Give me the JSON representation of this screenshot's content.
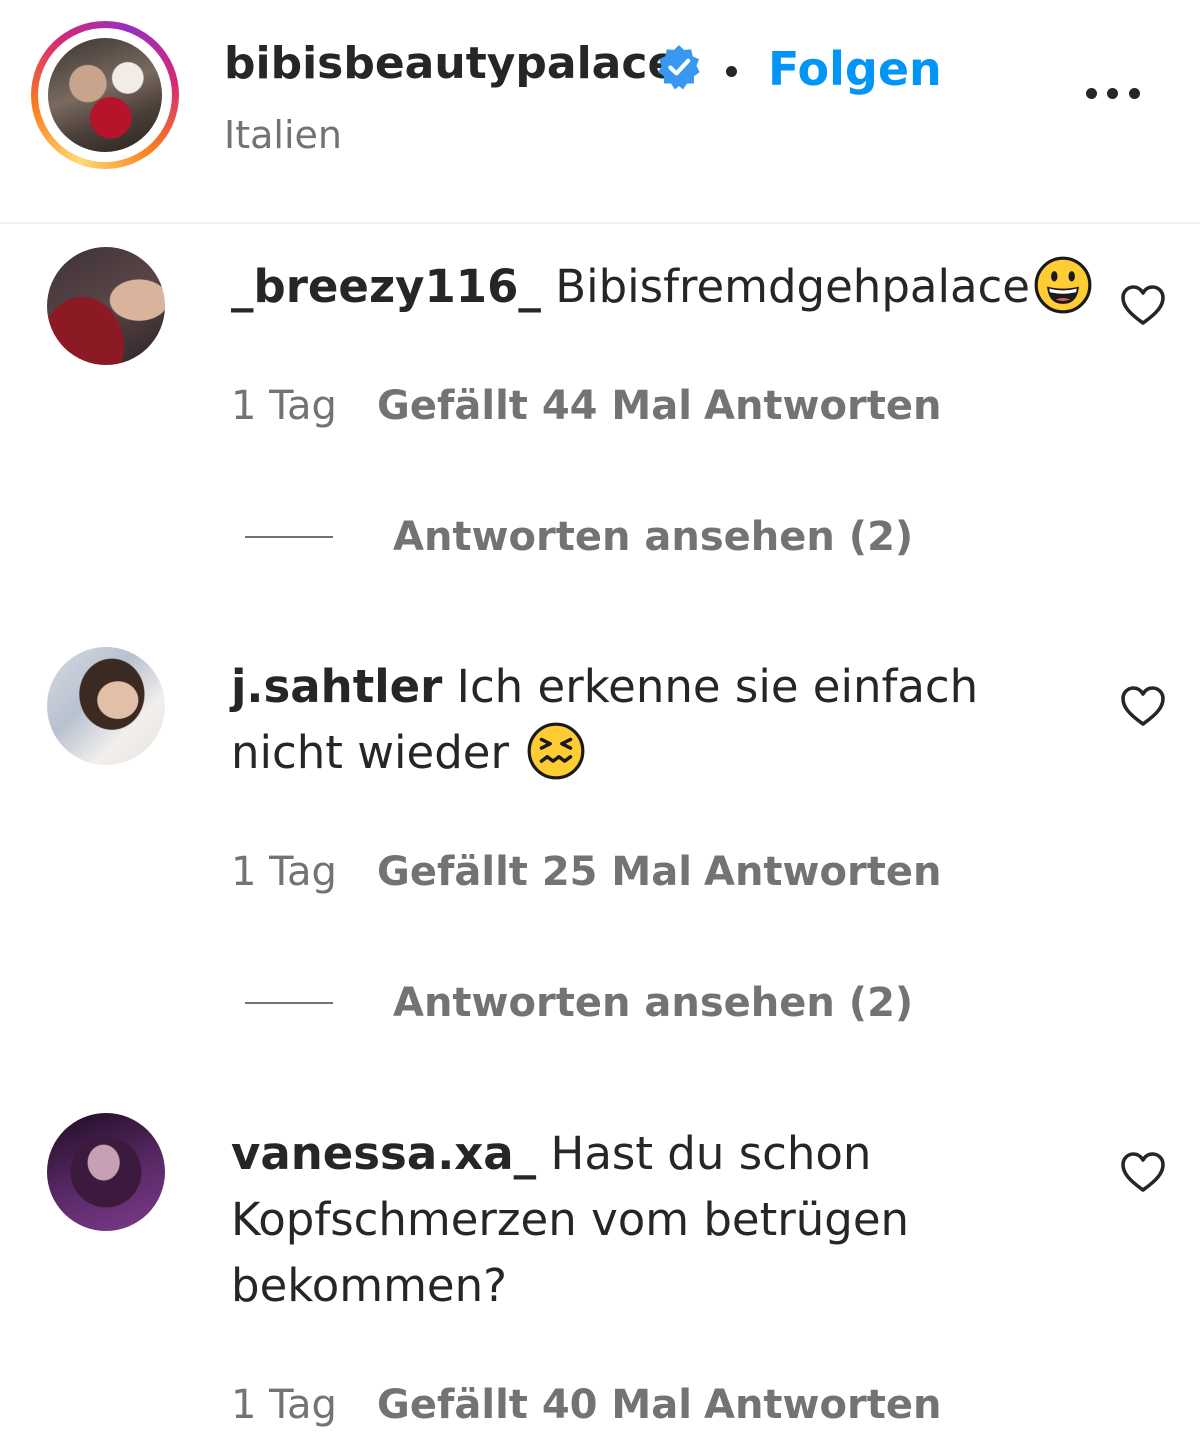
{
  "post_header": {
    "username": "bibisbeautypalace",
    "separator": "•",
    "follow_label": "Folgen",
    "location": "Italien",
    "colors": {
      "follow": "#0095f6",
      "verified": "#3897f0"
    },
    "icons": [
      "verified-badge-icon",
      "more-options-icon"
    ]
  },
  "comments": [
    {
      "username": "_breezy116_",
      "text": "Bibisfremdgehpalace",
      "emoji": "grinning-face",
      "time": "1 Tag",
      "likes": "Gefällt 44 Mal",
      "reply_label": "Antworten",
      "view_replies": "Antworten ansehen (2)"
    },
    {
      "username": "j.sahtler",
      "text": "Ich erkenne sie einfach nicht wieder",
      "emoji": "confounded-face",
      "time": "1 Tag",
      "likes": "Gefällt 25 Mal",
      "reply_label": "Antworten",
      "view_replies": "Antworten ansehen (2)"
    },
    {
      "username": "vanessa.xa_",
      "text": "Hast du schon Kopfschmerzen vom betrügen bekommen?",
      "time": "1 Tag",
      "likes": "Gefällt 40 Mal",
      "reply_label": "Antworten"
    }
  ]
}
